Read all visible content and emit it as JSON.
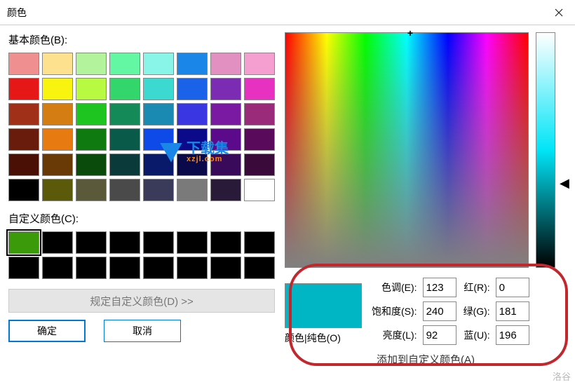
{
  "titlebar": {
    "title": "颜色"
  },
  "left": {
    "basic_label": "基本颜色(B):",
    "basic_colors": [
      "#ef8f8f",
      "#fde18e",
      "#b3f39b",
      "#63f7a3",
      "#88f5e8",
      "#1a87e8",
      "#e28fc1",
      "#f49fd0",
      "#e61717",
      "#f8f40f",
      "#b8f941",
      "#32d66b",
      "#3cd9d0",
      "#1a63e8",
      "#7c2cb2",
      "#e631c1",
      "#a03018",
      "#d37d12",
      "#1ec520",
      "#148a58",
      "#1a8ab2",
      "#3a36e1",
      "#7a1aa3",
      "#9a2a7a",
      "#6a1c0c",
      "#e87a12",
      "#0f7a0f",
      "#0a5a4a",
      "#0d4ae8",
      "#0a0a8a",
      "#5a0a8a",
      "#5a0a5a",
      "#4a1006",
      "#6a3a06",
      "#0a4a0a",
      "#0a3a3a",
      "#0a1a6a",
      "#0a0a4a",
      "#3a0a5a",
      "#3a0a3a",
      "#000000",
      "#5a5a0a",
      "#5a5a3a",
      "#4a4a4a",
      "#3a3a5a",
      "#7a7a7a",
      "#2a1a3a",
      "#ffffff"
    ],
    "custom_label": "自定义颜色(C):",
    "custom_colors": [
      "#3a9a0a",
      "#000000",
      "#000000",
      "#000000",
      "#000000",
      "#000000",
      "#000000",
      "#000000",
      "#000000",
      "#000000",
      "#000000",
      "#000000",
      "#000000",
      "#000000",
      "#000000",
      "#000000"
    ],
    "selected_custom_index": 0,
    "define_btn": "规定自定义颜色(D) >>",
    "ok_btn": "确定",
    "cancel_btn": "取消"
  },
  "right": {
    "preview_label": "颜色|纯色(O)",
    "preview_color": "#00b5c4",
    "hue_label": "色调(E):",
    "hue": "123",
    "sat_label": "饱和度(S):",
    "sat": "240",
    "lum_label": "亮度(L):",
    "lum": "92",
    "red_label": "红(R):",
    "red": "0",
    "green_label": "绿(G):",
    "green": "181",
    "blue_label": "蓝(U):",
    "blue": "196",
    "add_btn": "添加到自定义颜色(A)"
  },
  "watermark": "洛谷"
}
